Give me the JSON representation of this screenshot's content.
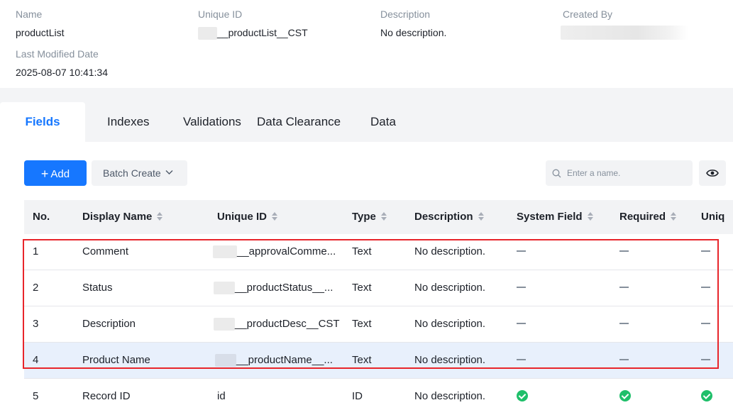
{
  "meta": {
    "name_label": "Name",
    "name_value": "productList",
    "unique_id_label": "Unique ID",
    "unique_id_value": "__productList__CST",
    "description_label": "Description",
    "description_value": "No description.",
    "created_by_label": "Created By",
    "last_modified_label": "Last Modified Date",
    "last_modified_value": "2025-08-07 10:41:34"
  },
  "tabs": [
    "Fields",
    "Indexes",
    "Validations",
    "Data Clearance",
    "Data"
  ],
  "active_tab": "Fields",
  "toolbar": {
    "add_label": "Add",
    "add_icon": "plus-icon",
    "batch_label": "Batch Create",
    "batch_icon": "chevron-down-icon",
    "search_placeholder": "Enter a name.",
    "search_icon": "search-icon",
    "view_icon": "eye-icon"
  },
  "table": {
    "columns": [
      "No.",
      "Display Name",
      "Unique ID",
      "Type",
      "Description",
      "System Field",
      "Required",
      "Uniq"
    ],
    "rows": [
      {
        "no": "1",
        "display_name": "Comment",
        "unique_id": "__approvalComme...",
        "type": "Text",
        "description": "No description.",
        "system_field": "dash",
        "required": "dash",
        "unique": "dash"
      },
      {
        "no": "2",
        "display_name": "Status",
        "unique_id": "__productStatus__...",
        "type": "Text",
        "description": "No description.",
        "system_field": "dash",
        "required": "dash",
        "unique": "dash"
      },
      {
        "no": "3",
        "display_name": "Description",
        "unique_id": "__productDesc__CST",
        "type": "Text",
        "description": "No description.",
        "system_field": "dash",
        "required": "dash",
        "unique": "dash"
      },
      {
        "no": "4",
        "display_name": "Product Name",
        "unique_id": "__productName__...",
        "type": "Text",
        "description": "No description.",
        "system_field": "dash",
        "required": "dash",
        "unique": "dash"
      },
      {
        "no": "5",
        "display_name": "Record ID",
        "unique_id": "id",
        "type": "ID",
        "description": "No description.",
        "system_field": "check",
        "required": "check",
        "unique": "check"
      }
    ]
  },
  "colors": {
    "accent": "#1677ff",
    "highlight_row": "#e8f0fc",
    "selection_border": "#e8252b",
    "check_green": "#1fbf6a"
  }
}
